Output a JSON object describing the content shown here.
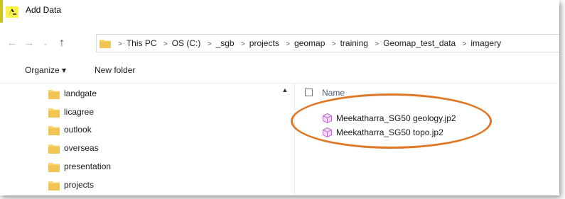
{
  "window": {
    "title": "Add Data"
  },
  "navigation": {
    "back": "←",
    "forward": "→",
    "recent": "⌄",
    "up": "↑"
  },
  "address": {
    "crumbs": [
      "This PC",
      "OS (C:)",
      "_sgb",
      "projects",
      "geomap",
      "training",
      "Geomap_test_data",
      "imagery"
    ]
  },
  "toolbar": {
    "organize_label": "Organize ▾",
    "new_folder_label": "New folder"
  },
  "sidebar": {
    "items": [
      {
        "label": "landgate"
      },
      {
        "label": "licagree"
      },
      {
        "label": "outlook"
      },
      {
        "label": "overseas"
      },
      {
        "label": "presentation"
      },
      {
        "label": "projects"
      }
    ]
  },
  "files": {
    "column_name": "Name",
    "items": [
      {
        "name": "Meekatharra_SG50 geology.jp2",
        "icon": "raster-file-icon"
      },
      {
        "name": "Meekatharra_SG50 topo.jp2",
        "icon": "raster-file-icon"
      }
    ]
  },
  "colors": {
    "folder": "#f8d775",
    "highlight": "#e07724",
    "raster_icon": "#b86bc7"
  }
}
